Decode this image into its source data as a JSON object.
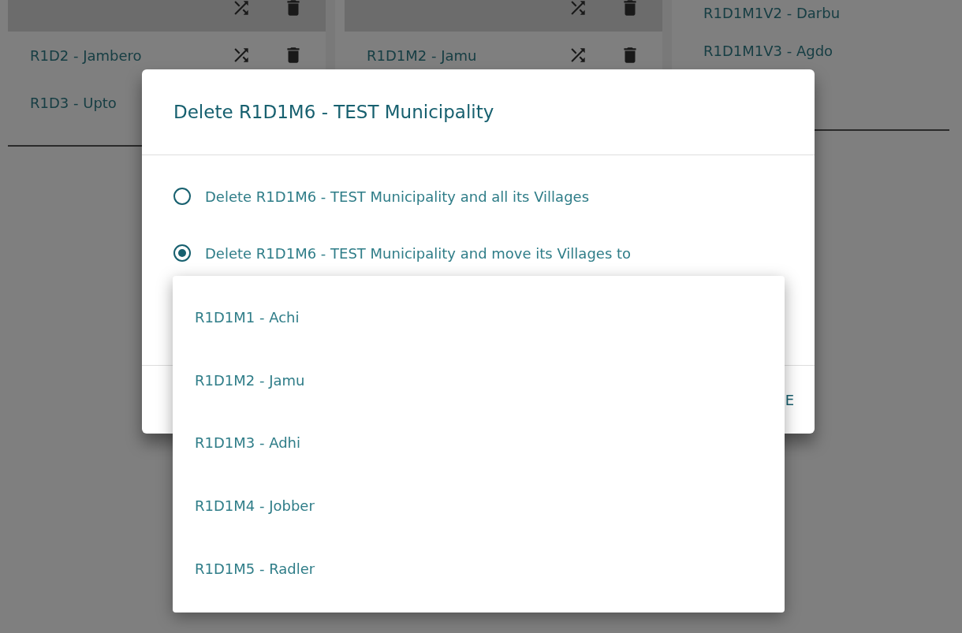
{
  "background_columns": [
    {
      "kind": "actions",
      "rows": [
        {
          "selected": true,
          "icons": true
        },
        {
          "label": "R1D2 - Jambero",
          "selected": false,
          "icons": true
        },
        {
          "label": "R1D3 - Upto",
          "selected": false
        }
      ]
    },
    {
      "kind": "actions",
      "rows": [
        {
          "selected": true,
          "icons": true
        },
        {
          "label": "R1D1M2 - Jamu",
          "selected": false,
          "icons": true
        }
      ]
    },
    {
      "kind": "plain",
      "rows": [
        {
          "label": "R1D1M1V2 - Darbu",
          "selected": false
        },
        {
          "label": "R1D1M1V3 - Agdo",
          "selected": false
        }
      ]
    }
  ],
  "dialog": {
    "title": "Delete R1D1M6 - TEST Municipality",
    "options": [
      {
        "label": "Delete R1D1M6 - TEST Municipality and all its Villages",
        "selected": false
      },
      {
        "label": "Delete R1D1M6 - TEST Municipality and move its Villages to",
        "selected": true
      }
    ],
    "action": "E"
  },
  "dropdown_menu": {
    "items": [
      {
        "label": "R1D1M1 - Achi"
      },
      {
        "label": "R1D1M2 - Jamu"
      },
      {
        "label": "R1D1M3 - Adhi"
      },
      {
        "label": "R1D1M4 - Jobber"
      },
      {
        "label": "R1D1M5 - Radler"
      }
    ]
  }
}
